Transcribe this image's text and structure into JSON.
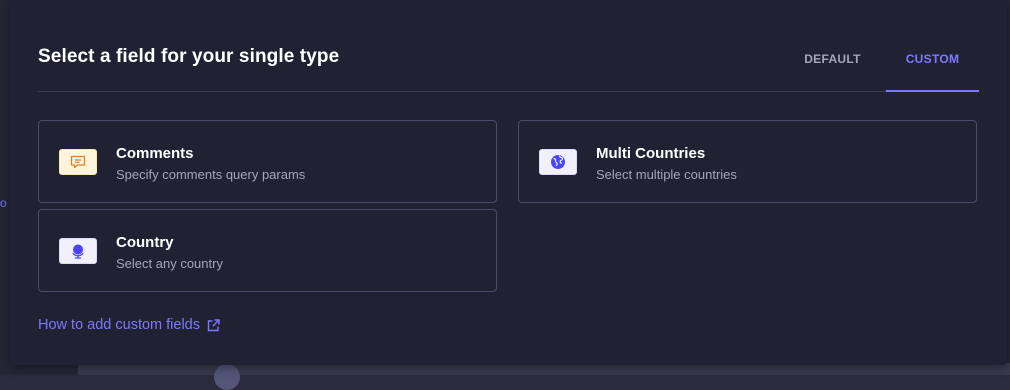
{
  "modal": {
    "title": "Select a field for your single type"
  },
  "tabs": [
    {
      "label": "DEFAULT",
      "active": false
    },
    {
      "label": "CUSTOM",
      "active": true
    }
  ],
  "fields": [
    {
      "title": "Comments",
      "description": "Specify comments query params",
      "icon": "comment-icon"
    },
    {
      "title": "Multi Countries",
      "description": "Select multiple countries",
      "icon": "globe-icon"
    },
    {
      "title": "Country",
      "description": "Select any country",
      "icon": "globe-stand-icon"
    }
  ],
  "help_link": {
    "label": "How to add custom fields",
    "icon": "external-link-icon"
  },
  "backdrop": {
    "mark": "o"
  },
  "colors": {
    "accent": "#7b79ff",
    "modal_bg": "#212134",
    "card_border": "#4a4a6a",
    "muted_text": "#a5a5ba"
  }
}
